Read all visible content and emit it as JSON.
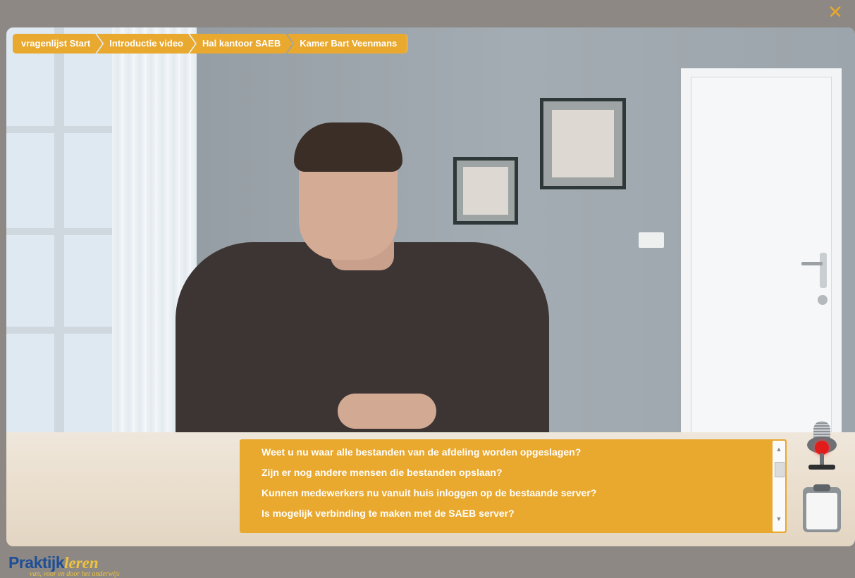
{
  "breadcrumb": {
    "items": [
      {
        "label": "vragenlijst Start"
      },
      {
        "label": "Introductie video"
      },
      {
        "label": "Hal kantoor SAEB"
      },
      {
        "label": "Kamer Bart Veenmans"
      }
    ]
  },
  "close": {
    "glyph": "✕"
  },
  "questions": {
    "items": [
      {
        "text": "Weet u nu waar alle bestanden van de afdeling worden opgeslagen?"
      },
      {
        "text": "Zijn er nog andere mensen die bestanden opslaan?"
      },
      {
        "text": "Kunnen medewerkers nu vanuit huis inloggen op de bestaande server?"
      },
      {
        "text": "Is mogelijk verbinding te maken met de SAEB server?"
      }
    ],
    "scroll_up": "▲",
    "scroll_down": "▼"
  },
  "logo": {
    "main": "Praktijk",
    "accent": "leren",
    "tagline": "van, voor en door het onderwijs"
  },
  "colors": {
    "accent": "#e9a82e",
    "brand_blue": "#1f4e96",
    "logo_yellow": "#f0c33c",
    "record_red": "#e21b1b"
  },
  "icons": {
    "close": "close-icon",
    "microphone": "microphone-icon",
    "clipboard": "clipboard-icon"
  }
}
